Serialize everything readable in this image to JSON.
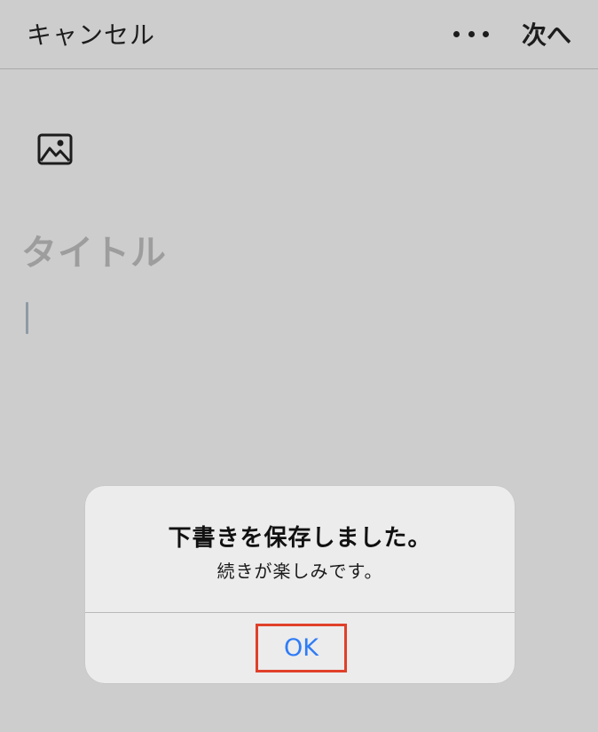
{
  "navbar": {
    "cancel_label": "キャンセル",
    "more_icon": "more-horizontal-icon",
    "next_label": "次へ"
  },
  "editor": {
    "image_icon": "image-icon",
    "title_placeholder": "タイトル"
  },
  "alert": {
    "title": "下書きを保存しました。",
    "message": "続きが楽しみです。",
    "ok_label": "OK"
  },
  "colors": {
    "background": "#cdcdcd",
    "alert_background": "#ececec",
    "accent_blue": "#2f7cf6",
    "highlight_red": "#e0402a",
    "placeholder_gray": "#9d9d9d"
  }
}
